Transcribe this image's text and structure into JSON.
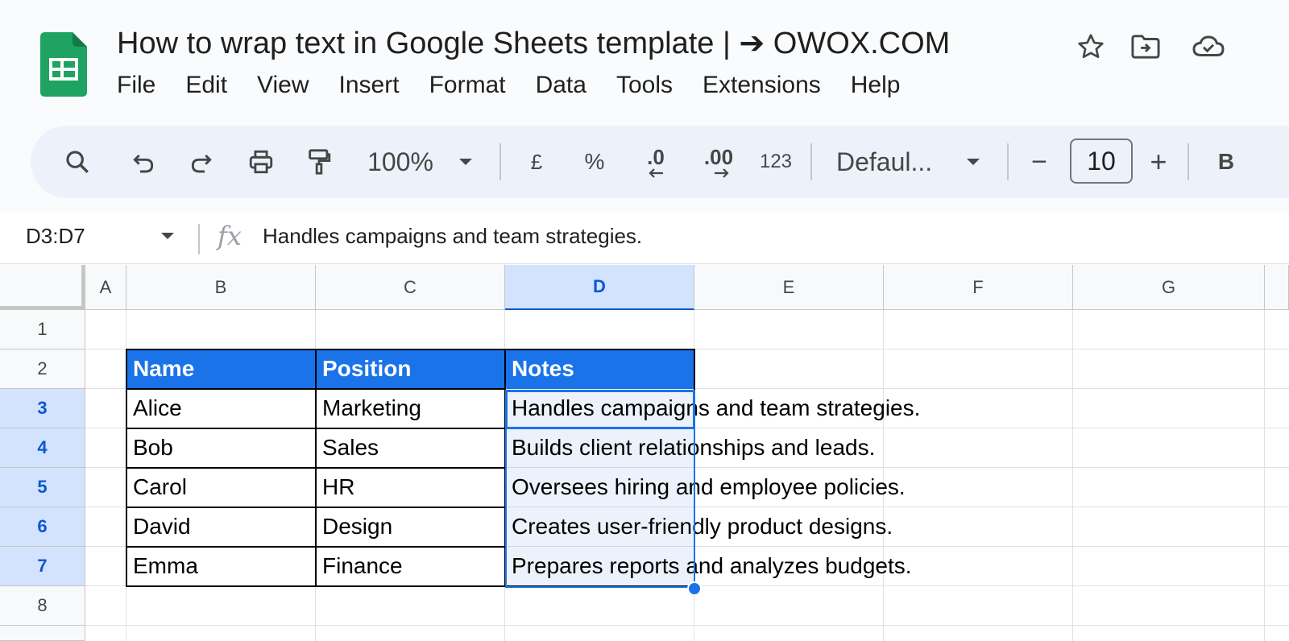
{
  "app": {
    "title": "How to wrap text in Google Sheets template | ➔ OWOX.COM",
    "menu": [
      "File",
      "Edit",
      "View",
      "Insert",
      "Format",
      "Data",
      "Tools",
      "Extensions",
      "Help"
    ],
    "header_icons": [
      "star-icon",
      "move-to-folder-icon",
      "cloud-saved-icon"
    ]
  },
  "toolbar": {
    "zoom": "100%",
    "currency": "£",
    "percent": "%",
    "decrease_decimal": ".0",
    "increase_decimal": ".00",
    "number_format": "123",
    "font": "Defaul...",
    "minus": "−",
    "font_size": "10",
    "plus": "+",
    "bold": "B"
  },
  "formula_bar": {
    "name_box": "D3:D7",
    "fx": "fx",
    "content": "Handles campaigns and team strategies."
  },
  "grid": {
    "columns": [
      "A",
      "B",
      "C",
      "D",
      "E",
      "F",
      "G"
    ],
    "rows": [
      "1",
      "2",
      "3",
      "4",
      "5",
      "6",
      "7",
      "8"
    ],
    "selected_column": "D",
    "selected_rows": [
      "3",
      "4",
      "5",
      "6",
      "7"
    ],
    "table": {
      "headers": [
        "Name",
        "Position",
        "Notes"
      ],
      "rows": [
        [
          "Alice",
          "Marketing",
          "Handles campaigns and team strategies."
        ],
        [
          "Bob",
          "Sales",
          "Builds client relationships and leads."
        ],
        [
          "Carol",
          "HR",
          "Oversees hiring and employee policies."
        ],
        [
          "David",
          "Design",
          "Creates user-friendly product designs."
        ],
        [
          "Emma",
          "Finance",
          "Prepares reports and analyzes budgets."
        ]
      ]
    }
  },
  "colors": {
    "header_fill": "#1a73e8",
    "selection": "#1a73e8",
    "logo_green": "#0f9d58"
  }
}
